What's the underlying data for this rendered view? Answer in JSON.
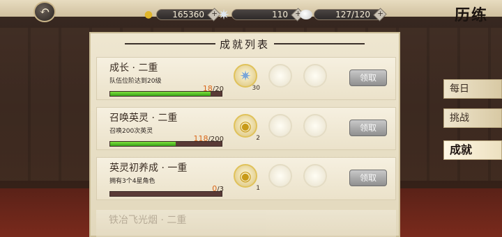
{
  "header": {
    "back_icon": "back-arrow-icon",
    "page_title": "历练",
    "resources": [
      {
        "icon": "coin-icon",
        "value": "165360"
      },
      {
        "icon": "star-crystal-icon",
        "value": "110"
      },
      {
        "icon": "jade-icon",
        "value": "127/120"
      }
    ],
    "plus_label": "+"
  },
  "panel": {
    "title": "成就列表",
    "claim_label": "领取",
    "achievements": [
      {
        "title": "成长 · 二重",
        "desc": "队伍位阶达到20级",
        "current": "18",
        "total": "/20",
        "progress": 0.9,
        "reward": {
          "icon": "star-crystal-icon",
          "qty": "30"
        }
      },
      {
        "title": "召唤英灵 · 二重",
        "desc": "召唤200次英灵",
        "current": "118",
        "total": "/200",
        "progress": 0.59,
        "reward": {
          "icon": "gold-coin-icon",
          "qty": "2"
        }
      },
      {
        "title": "英灵初养成 · 一重",
        "desc": "拥有3个4星角色",
        "current": "0",
        "total": "/3",
        "progress": 0,
        "reward": {
          "icon": "gold-coin-icon",
          "qty": "1"
        }
      }
    ],
    "partial_title": "铁冶飞光烟 · 二重"
  },
  "tabs": [
    {
      "label": "每日",
      "active": false
    },
    {
      "label": "挑战",
      "active": false
    },
    {
      "label": "成就",
      "active": true
    }
  ]
}
